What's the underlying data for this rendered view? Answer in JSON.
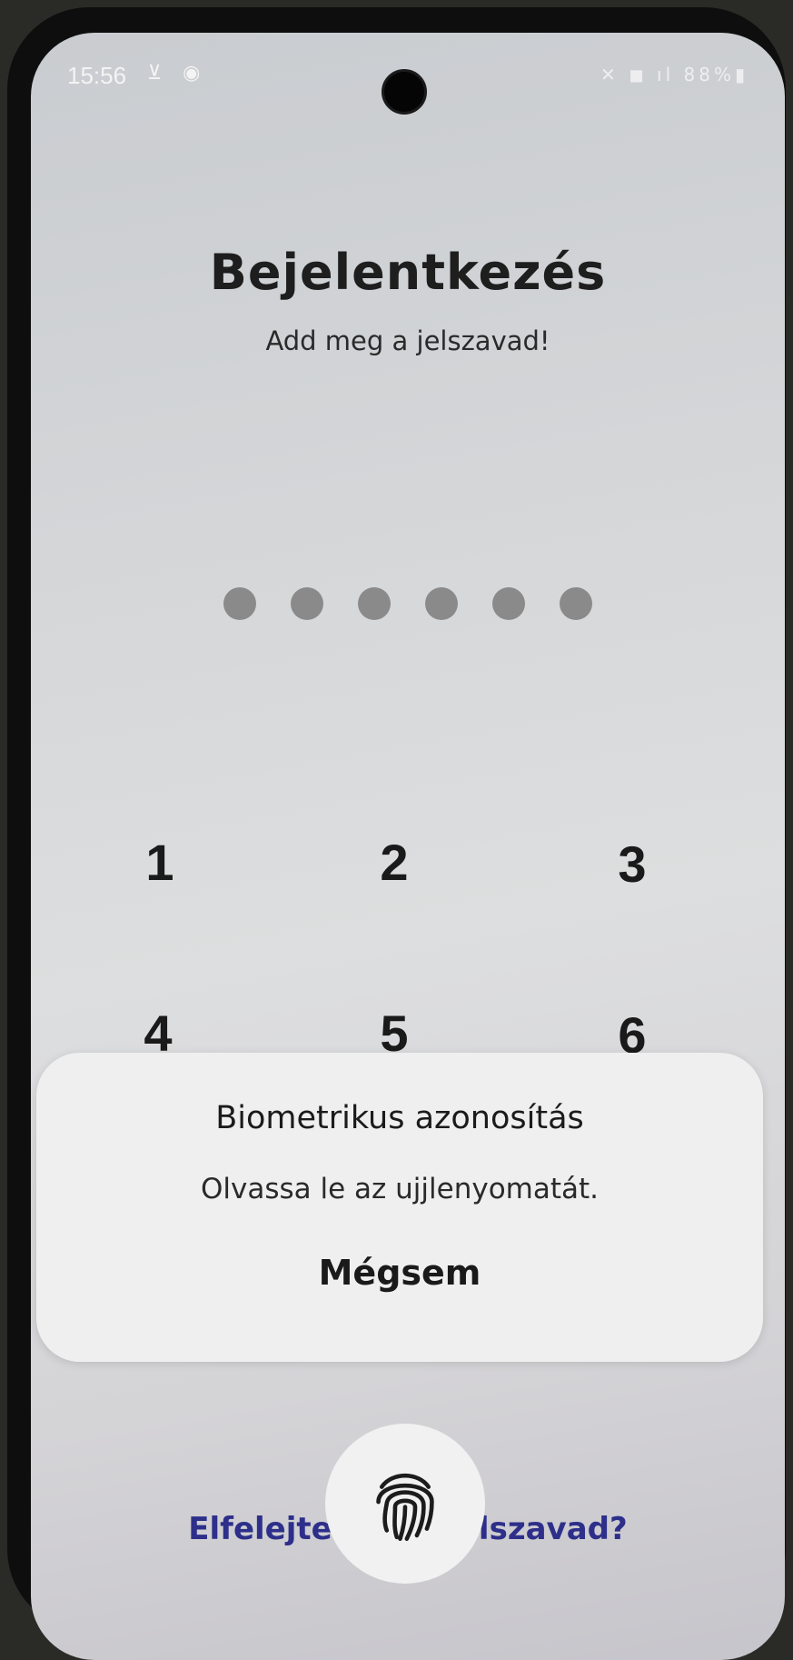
{
  "status_bar": {
    "time": "15:56",
    "left_icons": "⊻ ◉",
    "right_icons": "✕ ◼ ıl 88%▮"
  },
  "login": {
    "title": "Bejelentkezés",
    "subtitle": "Add meg a jelszavad!",
    "pin_dot_count": 6
  },
  "keypad": {
    "keys": [
      "1",
      "2",
      "3",
      "4",
      "5",
      "6"
    ]
  },
  "forgot_link": "Elfelejtetted a jelszavad?",
  "biometric_dialog": {
    "title": "Biometrikus azonosítás",
    "message": "Olvassa le az ujjlenyomatát.",
    "cancel_label": "Mégsem"
  },
  "icons": {
    "fingerprint": "fingerprint-icon"
  }
}
